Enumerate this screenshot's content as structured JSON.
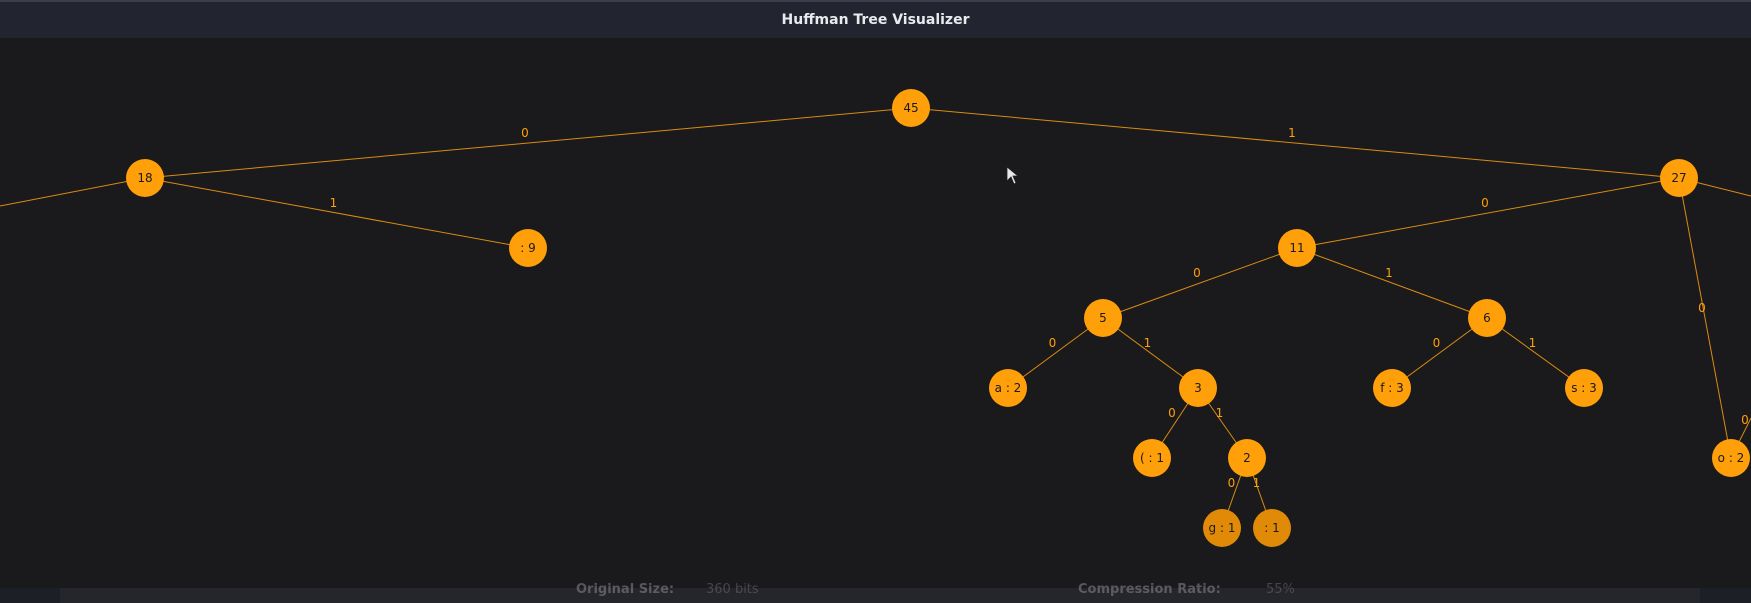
{
  "window": {
    "title": "Huffman Tree Visualizer"
  },
  "colors": {
    "node": "#ff9f0a",
    "node_dim": "#e08a08",
    "edge": "#d98c12",
    "text": "#1a1a1a",
    "background": "#1a191b"
  },
  "tree": {
    "nodes": [
      {
        "id": "n45",
        "label": "45"
      },
      {
        "id": "n18",
        "label": "18"
      },
      {
        "id": "n27",
        "label": "27"
      },
      {
        "id": "n9",
        "label": " : 9"
      },
      {
        "id": "n11",
        "label": "11"
      },
      {
        "id": "n5",
        "label": "5"
      },
      {
        "id": "n6",
        "label": "6"
      },
      {
        "id": "na2",
        "label": "a : 2"
      },
      {
        "id": "n3",
        "label": "3"
      },
      {
        "id": "nf3",
        "label": "f : 3"
      },
      {
        "id": "ns3",
        "label": "s : 3"
      },
      {
        "id": "nparen",
        "label": "( : 1"
      },
      {
        "id": "n2",
        "label": "2"
      },
      {
        "id": "ng1",
        "label": "g : 1"
      },
      {
        "id": "ncol1",
        "label": " : 1"
      },
      {
        "id": "no2",
        "label": "o : 2"
      }
    ],
    "edges": [
      {
        "from": "n45",
        "to": "n18",
        "bit": "0"
      },
      {
        "from": "n45",
        "to": "n27",
        "bit": "1"
      },
      {
        "from": "n18",
        "to": "n9",
        "bit": "1"
      },
      {
        "from": "n27",
        "to": "n11",
        "bit": "0"
      },
      {
        "from": "n11",
        "to": "n5",
        "bit": "0"
      },
      {
        "from": "n11",
        "to": "n6",
        "bit": "1"
      },
      {
        "from": "n5",
        "to": "na2",
        "bit": "0"
      },
      {
        "from": "n5",
        "to": "n3",
        "bit": "1"
      },
      {
        "from": "n6",
        "to": "nf3",
        "bit": "0"
      },
      {
        "from": "n6",
        "to": "ns3",
        "bit": "1"
      },
      {
        "from": "n3",
        "to": "nparen",
        "bit": "0"
      },
      {
        "from": "n3",
        "to": "n2",
        "bit": "1"
      },
      {
        "from": "n2",
        "to": "ng1",
        "bit": "0"
      },
      {
        "from": "n2",
        "to": "ncol1",
        "bit": "1"
      },
      {
        "from": "n27",
        "to": "no2",
        "bit": "0"
      }
    ]
  },
  "stats": {
    "original_label": "Original Size:",
    "original_value": "360 bits",
    "ratio_label": "Compression Ratio:",
    "ratio_value": "55%"
  }
}
